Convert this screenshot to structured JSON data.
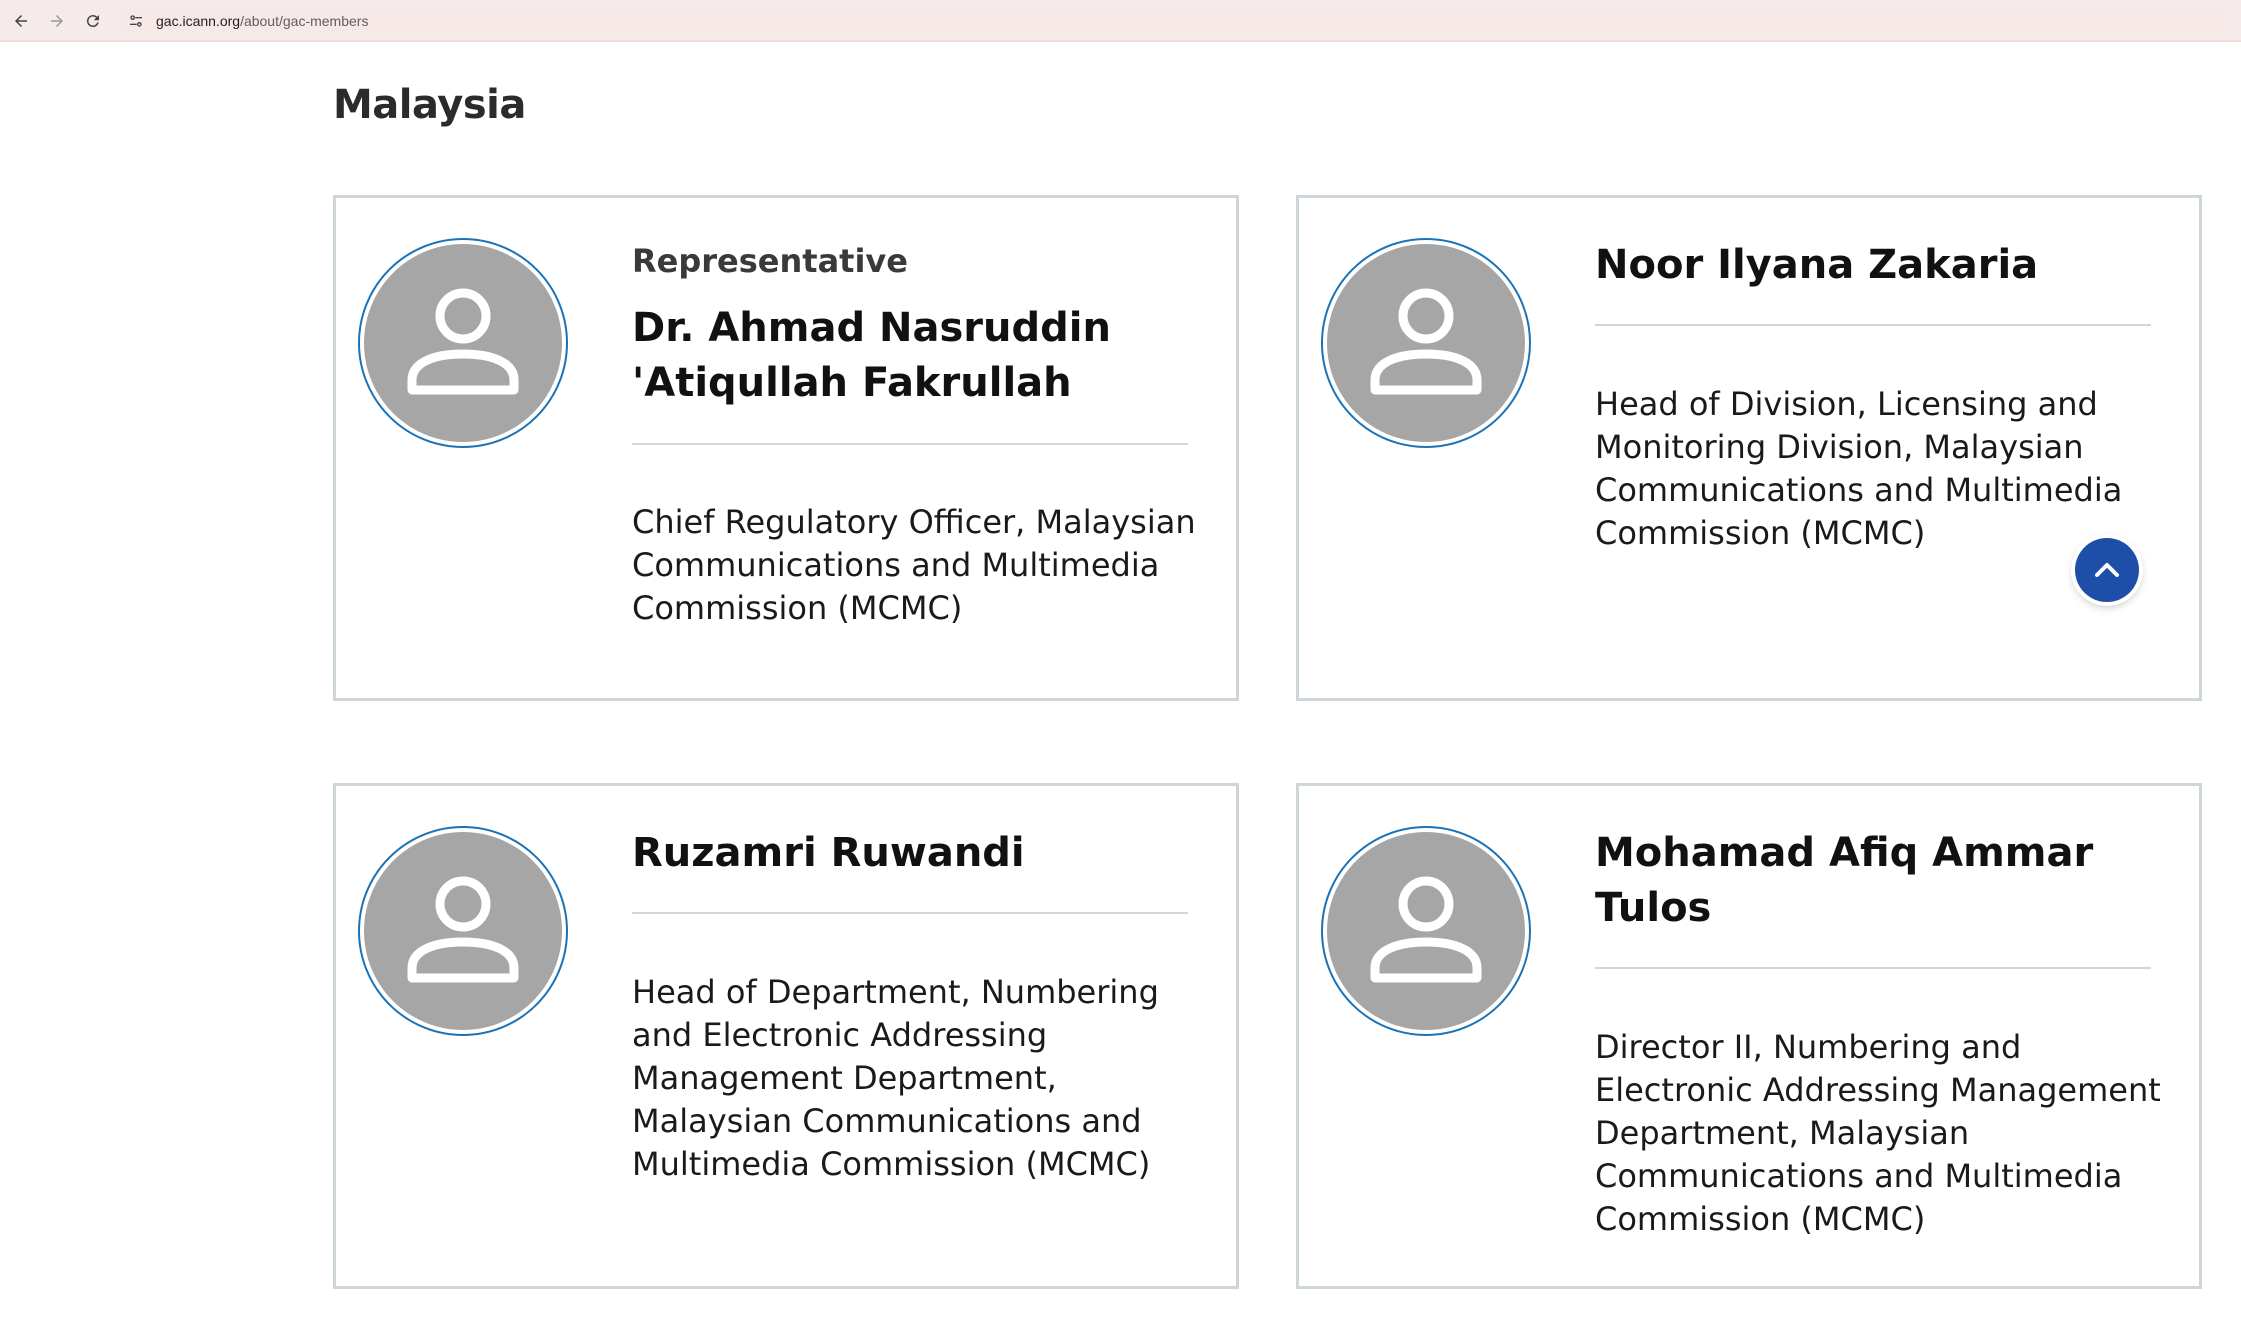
{
  "browser": {
    "url_domain": "gac.icann.org",
    "url_path": "/about/gac-members"
  },
  "page": {
    "title": "Malaysia"
  },
  "members": [
    {
      "role": "Representative",
      "name": "Dr. Ahmad Nasruddin 'Atiqullah Fakrullah",
      "title": "Chief Regulatory Officer, Malaysian Communications and Multimedia Commission (MCMC)"
    },
    {
      "role": "",
      "name": "Noor Ilyana Zakaria",
      "title": "Head of Division, Licensing and Monitoring Division, Malaysian Communications and Multimedia Commission (MCMC)"
    },
    {
      "role": "",
      "name": "Ruzamri Ruwandi",
      "title": "Head of Department, Numbering and Electronic Addressing Management Department, Malaysian Communications and Multimedia Commission (MCMC)"
    },
    {
      "role": "",
      "name": "Mohamad Afiq Ammar Tulos",
      "title": "Director II, Numbering and Electronic Addressing Management Department, Malaysian Communications and Multimedia Commission (MCMC)"
    }
  ],
  "icons": {
    "back": "arrow-left-icon",
    "forward": "arrow-right-icon",
    "reload": "reload-icon",
    "site_info": "tune-icon",
    "avatar": "user-icon",
    "scroll_top": "chevron-up-icon"
  },
  "colors": {
    "avatar_ring": "#1a73b8",
    "avatar_fill": "#a6a6a6",
    "scroll_button": "#1d4fa8",
    "card_border": "#cfd6d9",
    "chrome_bg": "#f5ebea"
  }
}
